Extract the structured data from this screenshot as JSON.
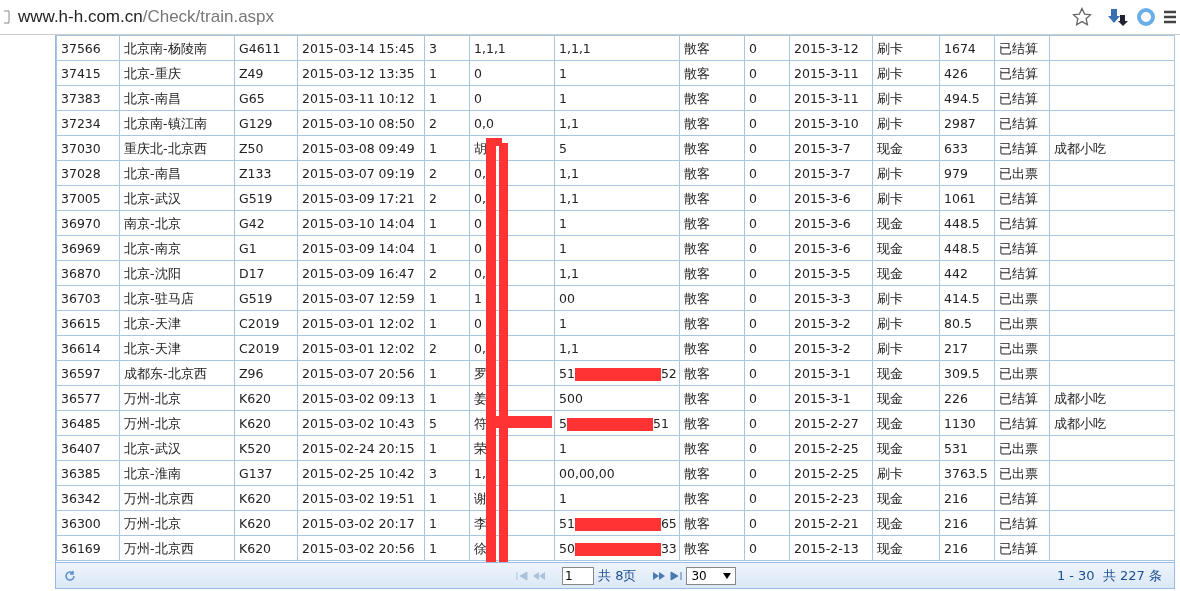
{
  "address_bar": {
    "host": "www.h-h.com.cn",
    "path": "/Check/train.aspx"
  },
  "table": {
    "rows": [
      {
        "cells": [
          "37566",
          "北京南-杨陵南",
          "G4611",
          "2015-03-14 15:45",
          "3",
          "1,1,1",
          "1,1,1",
          "散客",
          "0",
          "2015-3-12",
          "刷卡",
          "1674",
          "已结算",
          ""
        ]
      },
      {
        "cells": [
          "37415",
          "北京-重庆",
          "Z49",
          "2015-03-12 13:35",
          "1",
          "0",
          "1",
          "散客",
          "0",
          "2015-3-11",
          "刷卡",
          "426",
          "已结算",
          ""
        ]
      },
      {
        "cells": [
          "37383",
          "北京-南昌",
          "G65",
          "2015-03-11 10:12",
          "1",
          "0",
          "1",
          "散客",
          "0",
          "2015-3-11",
          "刷卡",
          "494.5",
          "已结算",
          ""
        ]
      },
      {
        "cells": [
          "37234",
          "北京南-镇江南",
          "G129",
          "2015-03-10 08:50",
          "2",
          "0,0",
          "1,1",
          "散客",
          "0",
          "2015-3-10",
          "刷卡",
          "2987",
          "已结算",
          ""
        ]
      },
      {
        "cells": [
          "37030",
          "重庆北-北京西",
          "Z50",
          "2015-03-08 09:49",
          "1",
          "胡",
          "5",
          "散客",
          "0",
          "2015-3-7",
          "现金",
          "633",
          "已结算",
          "成都小吃"
        ]
      },
      {
        "cells": [
          "37028",
          "北京-南昌",
          "Z133",
          "2015-03-07 09:19",
          "2",
          "0,",
          "1,1",
          "散客",
          "0",
          "2015-3-7",
          "刷卡",
          "979",
          "已出票",
          ""
        ]
      },
      {
        "cells": [
          "37005",
          "北京-武汉",
          "G519",
          "2015-03-09 17:21",
          "2",
          "0,",
          "1,1",
          "散客",
          "0",
          "2015-3-6",
          "刷卡",
          "1061",
          "已结算",
          ""
        ]
      },
      {
        "cells": [
          "36970",
          "南京-北京",
          "G42",
          "2015-03-10 14:04",
          "1",
          "0",
          "1",
          "散客",
          "0",
          "2015-3-6",
          "现金",
          "448.5",
          "已结算",
          ""
        ]
      },
      {
        "cells": [
          "36969",
          "北京-南京",
          "G1",
          "2015-03-09 14:04",
          "1",
          "0",
          "1",
          "散客",
          "0",
          "2015-3-6",
          "现金",
          "448.5",
          "已结算",
          ""
        ]
      },
      {
        "cells": [
          "36870",
          "北京-沈阳",
          "D17",
          "2015-03-09 16:47",
          "2",
          "0,",
          "1,1",
          "散客",
          "0",
          "2015-3-5",
          "现金",
          "442",
          "已结算",
          ""
        ]
      },
      {
        "cells": [
          "36703",
          "北京-驻马店",
          "G519",
          "2015-03-07 12:59",
          "1",
          "1",
          "00",
          "散客",
          "0",
          "2015-3-3",
          "刷卡",
          "414.5",
          "已出票",
          ""
        ]
      },
      {
        "cells": [
          "36615",
          "北京-天津",
          "C2019",
          "2015-03-01 12:02",
          "1",
          "0",
          "1",
          "散客",
          "0",
          "2015-3-2",
          "刷卡",
          "80.5",
          "已出票",
          ""
        ]
      },
      {
        "cells": [
          "36614",
          "北京-天津",
          "C2019",
          "2015-03-01 12:02",
          "2",
          "0,",
          "1,1",
          "散客",
          "0",
          "2015-3-2",
          "刷卡",
          "217",
          "已出票",
          ""
        ]
      },
      {
        "cells": [
          "36597",
          "成都东-北京西",
          "Z96",
          "2015-03-07 20:56",
          "1",
          "罗",
          [
            "51",
            "52"
          ],
          "散客",
          "0",
          "2015-3-1",
          "现金",
          "309.5",
          "已出票",
          ""
        ]
      },
      {
        "cells": [
          "36577",
          "万州-北京",
          "K620",
          "2015-03-02 09:13",
          "1",
          "姜",
          "500",
          "散客",
          "0",
          "2015-3-1",
          "现金",
          "226",
          "已结算",
          "成都小吃"
        ]
      },
      {
        "cells": [
          "36485",
          "万州-北京",
          "K620",
          "2015-03-02 10:43",
          "5",
          "符",
          [
            "5",
            "51"
          ],
          "散客",
          "0",
          "2015-2-27",
          "现金",
          "1130",
          "已结算",
          "成都小吃"
        ]
      },
      {
        "cells": [
          "36407",
          "北京-武汉",
          "K520",
          "2015-02-24 20:15",
          "1",
          "荣",
          "1",
          "散客",
          "0",
          "2015-2-25",
          "现金",
          "531",
          "已出票",
          ""
        ]
      },
      {
        "cells": [
          "36385",
          "北京-淮南",
          "G137",
          "2015-02-25 10:42",
          "3",
          "1,",
          "00,00,00",
          "散客",
          "0",
          "2015-2-25",
          "刷卡",
          "3763.5",
          "已出票",
          ""
        ]
      },
      {
        "cells": [
          "36342",
          "万州-北京西",
          "K620",
          "2015-03-02 19:51",
          "1",
          "谢",
          "1",
          "散客",
          "0",
          "2015-2-23",
          "现金",
          "216",
          "已结算",
          ""
        ]
      },
      {
        "cells": [
          "36300",
          "万州-北京",
          "K620",
          "2015-03-02 20:17",
          "1",
          "李",
          [
            "51",
            "65"
          ],
          "散客",
          "0",
          "2015-2-21",
          "现金",
          "216",
          "已结算",
          ""
        ]
      },
      {
        "cells": [
          "36169",
          "万州-北京西",
          "K620",
          "2015-03-02 20:56",
          "1",
          "徐",
          [
            "50",
            "33"
          ],
          "散客",
          "0",
          "2015-2-13",
          "现金",
          "216",
          "已结算",
          ""
        ]
      }
    ]
  },
  "pager": {
    "page": "1",
    "total_pages": "共 8页",
    "page_size": "30",
    "summary": "1 - 30  共 227 条"
  }
}
